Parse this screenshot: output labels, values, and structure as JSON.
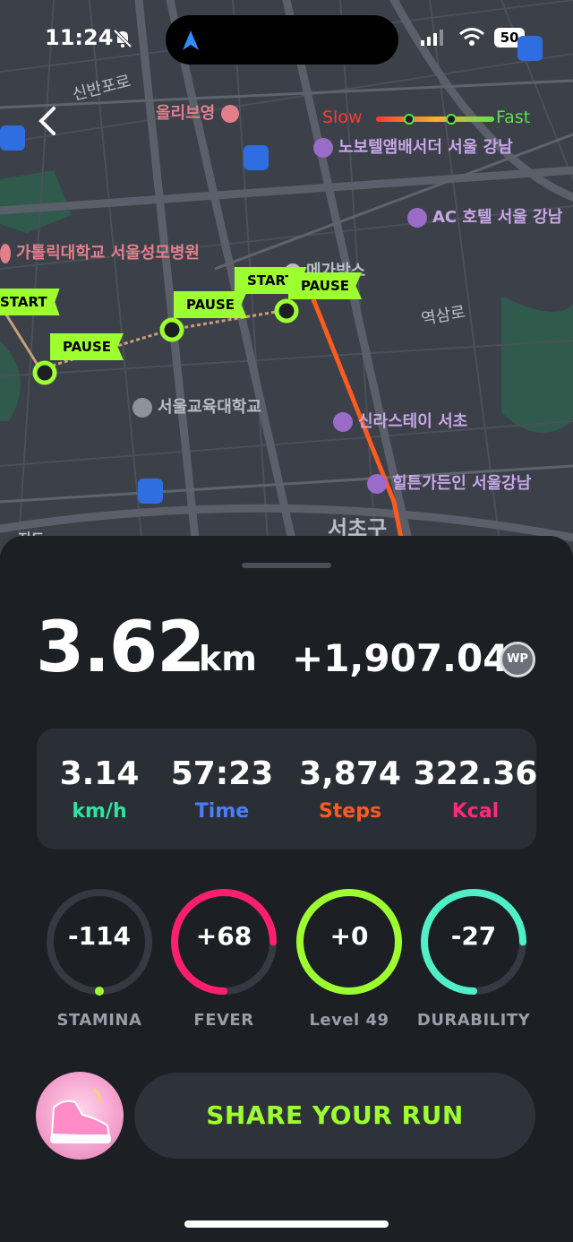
{
  "status_bar": {
    "time": "11:24",
    "battery": "50"
  },
  "map": {
    "legend": {
      "slow": "Slow",
      "fast": "Fast"
    },
    "labels": {
      "sinbanpo": "신반포로",
      "oliveyoung": "올리브영",
      "novotel": "노보텔앰배서더 서울 강남",
      "ac_hotel": "AC 호텔 서울 강남",
      "catholic": "가톨릭대학교 서울성모병원",
      "megabox": "메가박스",
      "yeoksamro": "역삼로",
      "seoul_edu": "서울교육대학교",
      "shilla": "신라스테이 서초",
      "hilton": "힐튼가든인 서울강남",
      "seocho": "서초구",
      "jido": "지도"
    },
    "flags": {
      "start_1": "START",
      "pause_1": "PAUSE",
      "pause_2": "PAUSE",
      "start_2": "START",
      "pause_3": "PAUSE"
    }
  },
  "summary": {
    "distance": "3.62",
    "distance_unit": "km",
    "wp_earned": "+1,907.04",
    "wp_badge": "WP"
  },
  "stats": [
    {
      "value": "3.14",
      "label": "km/h",
      "color": "#2fe3a0"
    },
    {
      "value": "57:23",
      "label": "Time",
      "color": "#4d7cff"
    },
    {
      "value": "3,874",
      "label": "Steps",
      "color": "#ff5a1f"
    },
    {
      "value": "322.36",
      "label": "Kcal",
      "color": "#ff2a7a"
    }
  ],
  "rings": [
    {
      "value": "-114",
      "label": "STAMINA",
      "color": "#9dff2f",
      "fill": 0.0
    },
    {
      "value": "+68",
      "label": "FEVER",
      "color": "#ff1f6e",
      "fill": 0.75
    },
    {
      "value": "+0",
      "label": "Level 49",
      "color": "#9dff2f",
      "fill": 1.0
    },
    {
      "value": "-27",
      "label": "DURABILITY",
      "color": "#4ff0c8",
      "fill": 0.75
    }
  ],
  "share_button": "SHARE YOUR RUN"
}
